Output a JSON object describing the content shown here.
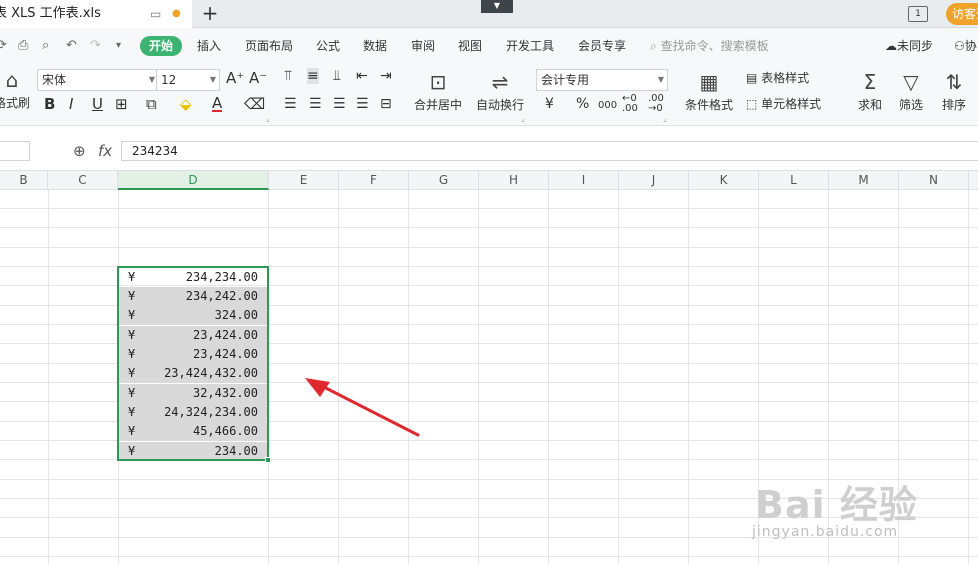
{
  "titlebar": {
    "doc_title": "表 XLS 工作表.xls",
    "new_tab": "+",
    "window_layout_label": "1",
    "visitor_label": "访客登录"
  },
  "menubar": {
    "items": [
      "开始",
      "插入",
      "页面布局",
      "公式",
      "数据",
      "审阅",
      "视图",
      "开发工具",
      "会员专享"
    ],
    "search_placeholder": "查找命令、搜索模板",
    "sync_label": "未同步",
    "collab_label": "协"
  },
  "ribbon": {
    "format_painter": "格式刷",
    "font_name": "宋体",
    "font_size": "12",
    "merge_center": "合并居中",
    "wrap_text": "自动换行",
    "number_format": "会计专用",
    "currency_symbol": "¥",
    "percent_symbol": "%",
    "thousands_symbol": "000",
    "cond_format": "条件格式",
    "table_style": "表格样式",
    "cell_style": "单元格样式",
    "sum": "求和",
    "filter": "筛选",
    "sort": "排序"
  },
  "formula_bar": {
    "fx_label": "fx",
    "value": "234234"
  },
  "columns": [
    "B",
    "C",
    "D",
    "E",
    "F",
    "G",
    "H",
    "I",
    "J",
    "K",
    "L",
    "M",
    "N"
  ],
  "selected_column": "D",
  "cells": [
    {
      "currency": "¥",
      "value": "234,234.00"
    },
    {
      "currency": "¥",
      "value": "234,242.00"
    },
    {
      "currency": "¥",
      "value": "324.00"
    },
    {
      "currency": "¥",
      "value": "23,424.00"
    },
    {
      "currency": "¥",
      "value": "23,424.00"
    },
    {
      "currency": "¥",
      "value": "23,424,432.00"
    },
    {
      "currency": "¥",
      "value": "32,432.00"
    },
    {
      "currency": "¥",
      "value": "24,324,234.00"
    },
    {
      "currency": "¥",
      "value": "45,466.00"
    },
    {
      "currency": "¥",
      "value": "234.00"
    }
  ],
  "watermark": {
    "main": "Bai 经验",
    "sub": "jingyan.baidu.com"
  },
  "colors": {
    "accent_green": "#2c9a56",
    "arrow_red": "#e0282f",
    "selection_fill": "#d9d9d9"
  }
}
